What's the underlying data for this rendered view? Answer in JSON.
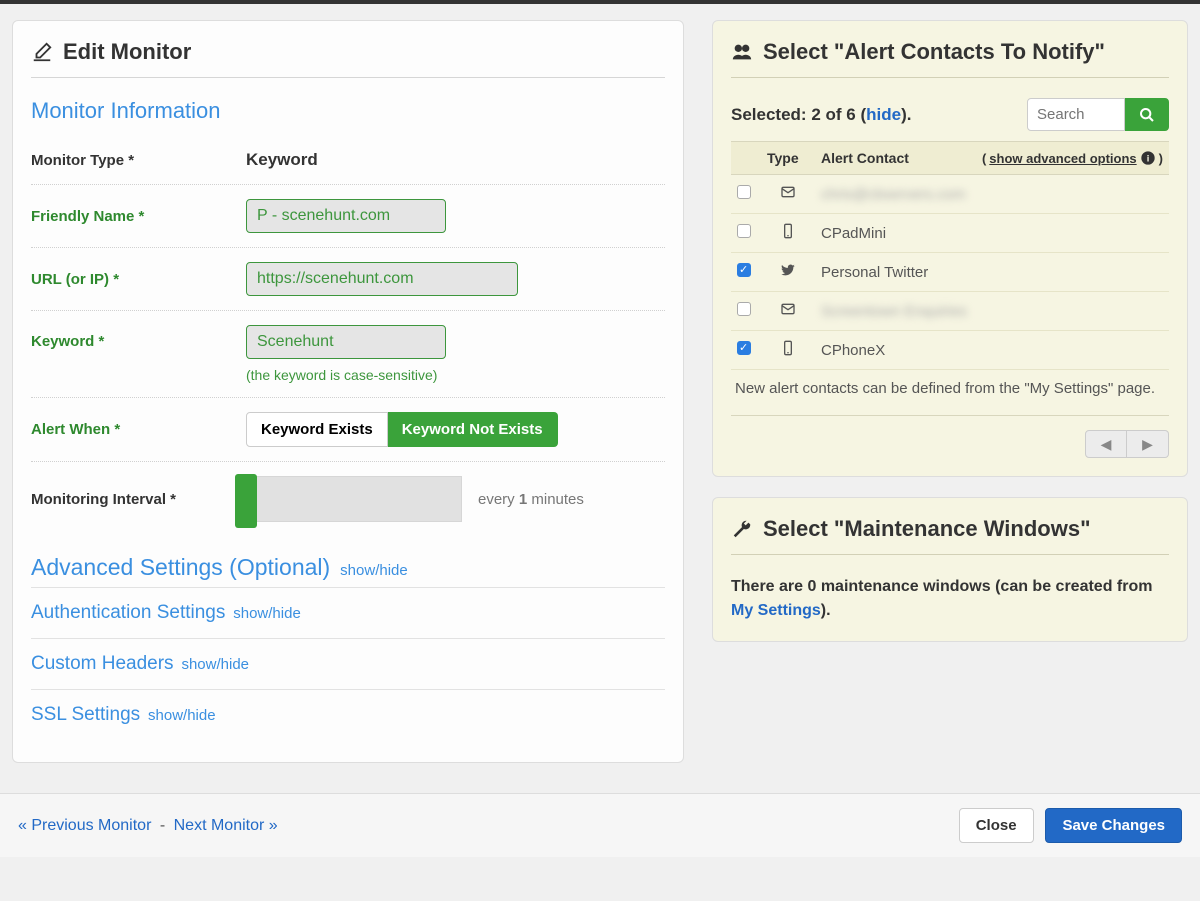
{
  "left": {
    "title": "Edit Monitor",
    "section_info": "Monitor Information",
    "monitor_type_label": "Monitor Type *",
    "monitor_type_value": "Keyword",
    "friendly_name_label": "Friendly Name *",
    "friendly_name_value": "P - scenehunt.com",
    "url_label": "URL (or IP) *",
    "url_value": "https://scenehunt.com",
    "keyword_label": "Keyword *",
    "keyword_value": "Scenehunt",
    "keyword_hint": "(the keyword is case-sensitive)",
    "alert_when_label": "Alert When *",
    "alert_when_opts": [
      "Keyword Exists",
      "Keyword Not Exists"
    ],
    "alert_when_selected": 1,
    "interval_label": "Monitoring Interval *",
    "interval_prefix": "every ",
    "interval_value": "1",
    "interval_suffix": " minutes",
    "advanced_title": "Advanced Settings (Optional)",
    "auth_title": "Authentication Settings",
    "headers_title": "Custom Headers",
    "ssl_title": "SSL Settings",
    "showhide": "show/hide"
  },
  "contacts": {
    "title": "Select \"Alert Contacts To Notify\"",
    "selected_prefix": "Selected: ",
    "selected_count": "2 of 6",
    "selected_open": " (",
    "hide_label": "hide",
    "selected_close": ").",
    "search_placeholder": "Search",
    "th_type": "Type",
    "th_contact": "Alert Contact",
    "show_adv": "show advanced options",
    "rows": [
      {
        "checked": false,
        "icon": "mail",
        "text": "chris@cbservers.com",
        "blurred": true
      },
      {
        "checked": false,
        "icon": "phone",
        "text": "CPadMini",
        "blurred": false
      },
      {
        "checked": true,
        "icon": "twitter",
        "text": "Personal Twitter",
        "blurred": false
      },
      {
        "checked": false,
        "icon": "mail",
        "text": "Screentown Enquiries",
        "blurred": true
      },
      {
        "checked": true,
        "icon": "phone",
        "text": "CPhoneX",
        "blurred": false
      }
    ],
    "note": "New alert contacts can be defined from the \"My Settings\" page."
  },
  "mw": {
    "title": "Select \"Maintenance Windows\"",
    "text_a": "There are 0 maintenance windows (can be created from ",
    "link": "My Settings",
    "text_b": ")."
  },
  "footer": {
    "prev": "« Previous Monitor",
    "sep": "-",
    "next": "Next Monitor »",
    "close": "Close",
    "save": "Save Changes"
  }
}
